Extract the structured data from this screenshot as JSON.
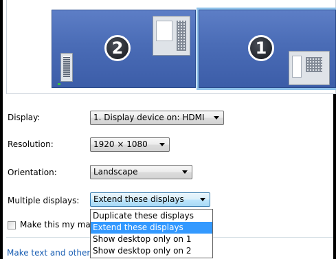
{
  "monitors": [
    {
      "number": "2",
      "selected": false
    },
    {
      "number": "1",
      "selected": true
    }
  ],
  "display": {
    "label": "Display:",
    "value": "1. Display device on: HDMI"
  },
  "resolution": {
    "label": "Resolution:",
    "value": "1920 × 1080"
  },
  "orientation": {
    "label": "Orientation:",
    "value": "Landscape"
  },
  "multiple_displays": {
    "label": "Multiple displays:",
    "value": "Extend these displays",
    "options": [
      "Duplicate these displays",
      "Extend these displays",
      "Show desktop only on 1",
      "Show desktop only on 2"
    ],
    "highlighted_option": "Extend these displays"
  },
  "main_display_checkbox": {
    "label": "Make this my ma",
    "checked": false
  },
  "link_text": "Make text and other",
  "colors": {
    "monitor_fill": "#4a6cb6",
    "selection_glow": "#8fc2ea",
    "highlight": "#3399ff",
    "link": "#1a5fb4"
  },
  "icons": [
    "window-thumbnail-icon",
    "taskbar-icon"
  ]
}
